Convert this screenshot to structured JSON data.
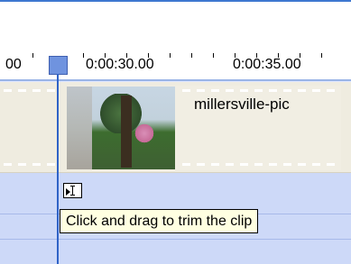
{
  "timeline": {
    "ruler_labels": [
      "00",
      "0:00:30.00",
      "0:00:35.00"
    ]
  },
  "video_track": {
    "clip_name": "millersville-pic"
  },
  "tooltip": {
    "text": "Click and drag to trim the clip"
  },
  "colors": {
    "playhead": "#2f63c7",
    "playhead_handle": "#6f93df",
    "track_bg": "#cdd9f8",
    "clip_strip_bg": "#efece0",
    "tooltip_bg": "#ffffe1"
  },
  "icons": {
    "playhead_handle": "playhead-handle-icon",
    "trim_cursor": "trim-cursor-icon"
  }
}
